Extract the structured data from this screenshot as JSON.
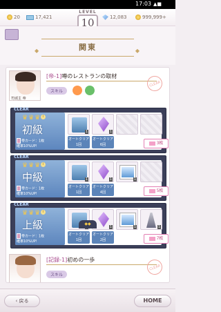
{
  "status": {
    "time": "17:03"
  },
  "resources": {
    "coins": "20",
    "tickets": "17,421",
    "gems": "12,083",
    "money": "999,999+"
  },
  "level": {
    "label": "LEVEL",
    "value": "10"
  },
  "region": {
    "title": "関東"
  },
  "missions": [
    {
      "tag": "[帝-1]",
      "title": "噂のレストランの取材",
      "person": "司城主 帝",
      "skill": "スキル"
    },
    {
      "tag": "[記録-1]",
      "title": "初めの一歩",
      "skill": "スキル"
    }
  ],
  "grades": [
    {
      "clear": "CLEAR",
      "name": "初級",
      "card_text": "帝カード：1枚",
      "rate_text": "確率10%UP!",
      "auto1": "オートクリア",
      "auto1_count": "1回",
      "auto2": "オートクリア",
      "auto2_count": "6回",
      "ticket": "3枚",
      "slot_counts": [
        "1",
        "1"
      ]
    },
    {
      "clear": "CLEAR",
      "name": "中級",
      "card_text": "帝カード：1枚",
      "rate_text": "確率10%UP!",
      "auto1": "オートクリア",
      "auto1_count": "1回",
      "auto2": "オートクリア",
      "auto2_count": "4回",
      "ticket": "5枚",
      "slot_counts": [
        "1",
        "1",
        "1"
      ]
    },
    {
      "clear": "CLEAR",
      "name": "上級",
      "card_text": "帝カード：1枚",
      "rate_text": "確率10%UP!",
      "auto1": "オートクリア",
      "auto1_count": "1回",
      "auto2": "オートクリア",
      "auto2_count": "2回",
      "ticket": "7枚",
      "slot_counts": [
        "1",
        "1",
        "1",
        "1"
      ]
    }
  ],
  "buttons": {
    "back": "戻る",
    "home": "HOME"
  },
  "colors": {
    "accent": "#c0467f",
    "panel": "#3b3f59"
  }
}
